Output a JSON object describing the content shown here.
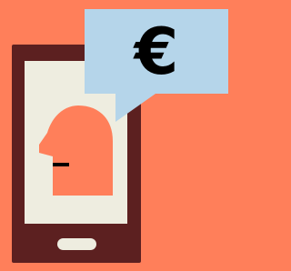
{
  "illustration": {
    "bubble_symbol": "€",
    "icons": {
      "phone": "smartphone-icon",
      "person": "person-head-icon",
      "bubble": "speech-bubble-icon"
    },
    "colors": {
      "background": "#ff7f5a",
      "phone_body": "#5c2020",
      "screen": "#eeede0",
      "person": "#ff7f5a",
      "bubble": "#b5d5ea",
      "symbol": "#000000",
      "home_button": "#eeede0"
    }
  }
}
